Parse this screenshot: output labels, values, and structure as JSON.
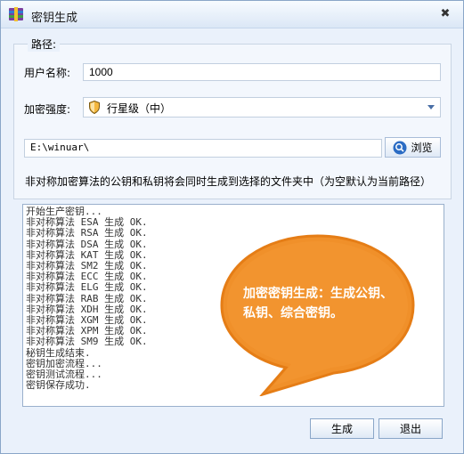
{
  "window": {
    "title": "密钥生成"
  },
  "path_group": {
    "legend": "路径:"
  },
  "username": {
    "label": "用户名称:",
    "value": "1000"
  },
  "strength": {
    "label": "加密强度:",
    "selected": "行星级（中）"
  },
  "path": {
    "value": "E:\\winuar\\"
  },
  "browse": {
    "label": "浏览"
  },
  "note": "非对称加密算法的公钥和私钥将会同时生成到选择的文件夹中（为空默认为当前路径）",
  "log": {
    "lines": [
      "开始生产密钥...",
      "非对称算法 ESA 生成 OK.",
      "非对称算法 RSA 生成 OK.",
      "非对称算法 DSA 生成 OK.",
      "非对称算法 KAT 生成 OK.",
      "非对称算法 SM2 生成 OK.",
      "非对称算法 ECC 生成 OK.",
      "非对称算法 ELG 生成 OK.",
      "非对称算法 RAB 生成 OK.",
      "非对称算法 XDH 生成 OK.",
      "非对称算法 XGM 生成 OK.",
      "非对称算法 XPM 生成 OK.",
      "非对称算法 SM9 生成 OK.",
      "秘钥生成结束.",
      "密钥加密流程...",
      "密钥测试流程...",
      "密钥保存成功."
    ]
  },
  "callout": {
    "text": "加密密钥生成：生成公钥、私钥、综合密钥。",
    "color": "#f0902a"
  },
  "buttons": {
    "generate": "生成",
    "exit": "退出"
  }
}
